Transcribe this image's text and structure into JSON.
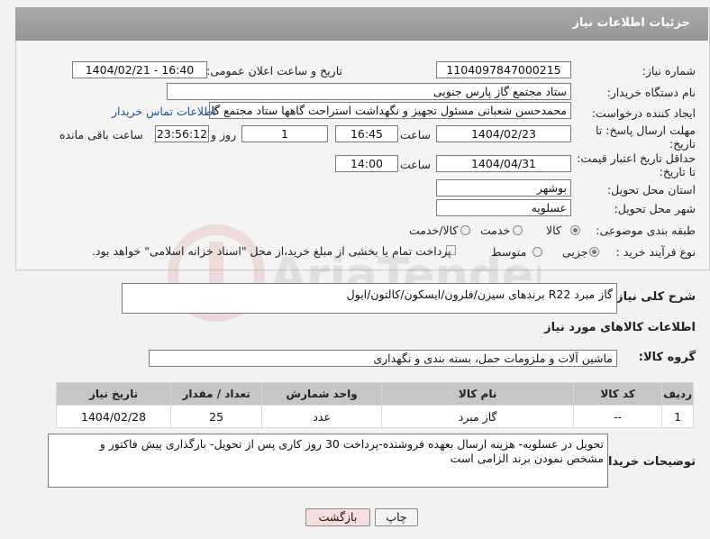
{
  "header": {
    "title": "جزئیات اطلاعات نیاز"
  },
  "fields": {
    "need_number_label": "شماره نیاز:",
    "need_number": "1104097847000215",
    "announce_label": "تاریخ و ساعت اعلان عمومی:",
    "announce_value": "1404/02/21 - 16:40",
    "buyer_org_label": "نام دستگاه خریدار:",
    "buyer_org": "ستاد مجتمع گاز پارس جنوبی",
    "creator_label": "ایجاد کننده درخواست:",
    "creator": "محمدحسن شعبانی مسئول تجهیز و نگهداشت استراحت گاهها ستاد مجتمع گا",
    "contact_link": "اطلاعات تماس خریدار",
    "deadline_label_1": "مهلت ارسال پاسخ: تا",
    "deadline_label_2": "تاریخ:",
    "deadline_date": "1404/02/23",
    "time_label": "ساعت",
    "deadline_time": "16:45",
    "days_value": "1",
    "days_label": "روز و",
    "remaining_value": "23:56:12",
    "remaining_label": "ساعت باقی مانده",
    "min_validity_label_1": "حداقل تاریخ اعتبار قیمت:",
    "min_validity_label_2": "تا تاریخ:",
    "validity_date": "1404/04/31",
    "validity_time": "14:00",
    "province_label": "استان محل تحویل:",
    "province": "بوشهر",
    "city_label": "شهر محل تحویل:",
    "city": "عسلویه",
    "category_label": "طبقه بندی موضوعی:",
    "category_options": [
      "کالا",
      "خدمت",
      "کالا/خدمت"
    ],
    "purchase_type_label": "نوع فرآیند خرید :",
    "purchase_options": [
      "جزیی",
      "متوسط"
    ],
    "payment_note": "پرداخت تمام یا بخشی از مبلغ خرید،از محل \"اسناد خزانه اسلامی\" خواهد بود."
  },
  "description": {
    "label": "شرح کلی نیاز:",
    "value": "گاز مبرد R22  برندهای سیزن/فلرون/ایسکون/کالتون/ایول"
  },
  "goods_section_title": "اطلاعات کالاهای مورد نیاز",
  "goods_group": {
    "label": "گروه کالا:",
    "value": "ماشین آلات و ملزومات حمل، بسته بندی و نگهداری"
  },
  "table": {
    "headers": [
      "ردیف",
      "کد کالا",
      "نام کالا",
      "واحد شمارش",
      "تعداد / مقدار",
      "تاریخ نیاز"
    ],
    "rows": [
      {
        "row": "1",
        "code": "--",
        "name": "گاز مبرد",
        "unit": "عدد",
        "qty": "25",
        "date": "1404/02/28"
      }
    ]
  },
  "buyer_notes": {
    "label": "توضیحات خریدار:",
    "value": "تحویل در عسلویه- هزینه ارسال بعهده فروشنده-پرداخت 30 روز کاری پس از تحویل- بارگذاری پیش فاکتور و مشخص نمودن برند الزامی است"
  },
  "buttons": {
    "print": "چاپ",
    "back": "بازگشت"
  },
  "watermark": "AriaTender.neT",
  "colors": {
    "header_bg": "#a3a3a3",
    "table_header_bg": "#c6c6c6",
    "link": "#1a4f9e",
    "back_btn_bg": "#f7dede"
  }
}
